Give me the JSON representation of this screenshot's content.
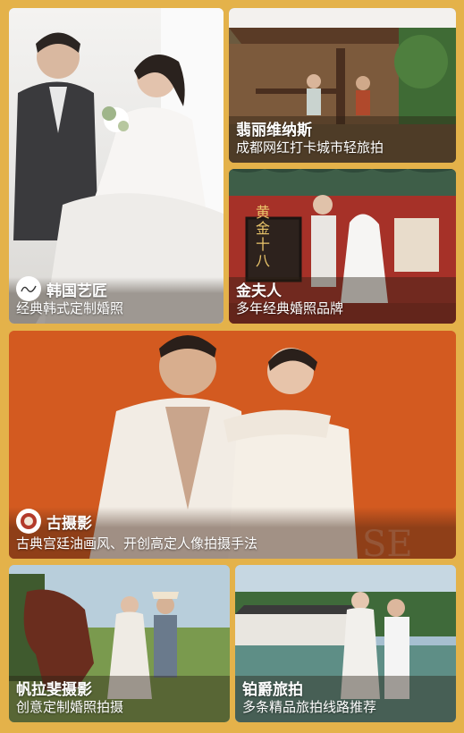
{
  "cards": [
    {
      "title": "韩国艺匠",
      "subtitle": "经典韩式定制婚照",
      "has_logo": true,
      "logo_icon": "studio-logo-icon"
    },
    {
      "title": "翡丽维纳斯",
      "subtitle": "成都网红打卡城市轻旅拍"
    },
    {
      "title": "金夫人",
      "subtitle": "多年经典婚照品牌",
      "photo_text": "黄金十八"
    },
    {
      "title": "古摄影",
      "subtitle": "古典宫廷油画风、开创高定人像拍摄手法",
      "has_logo": true,
      "logo_icon": "studio-logo-icon"
    },
    {
      "title": "帆拉斐摄影",
      "subtitle": "创意定制婚照拍摄"
    },
    {
      "title": "铂爵旅拍",
      "subtitle": "多条精品旅拍线路推荐"
    }
  ],
  "colors": {
    "background": "#E4B24A",
    "orange_backdrop": "#D4581E",
    "red_wall": "#9E2A22"
  }
}
